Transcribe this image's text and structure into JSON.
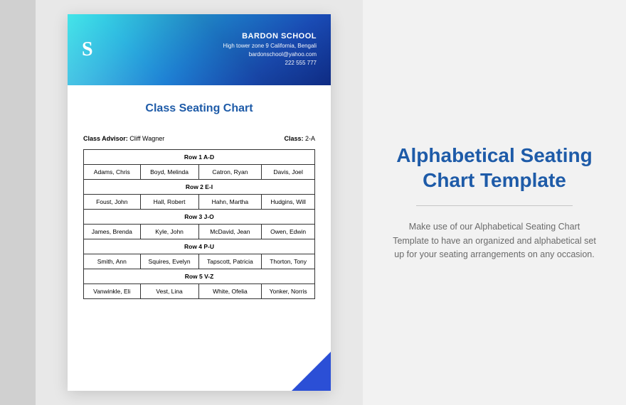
{
  "document": {
    "logo_text": "S",
    "school": {
      "name": "BARDON SCHOOL",
      "address": "High tower zone 9 California, Bengali",
      "email": "bardonschool@yahoo.com",
      "phone": "222 555 777"
    },
    "title": "Class Seating Chart",
    "meta": {
      "advisor_label": "Class Advisor:",
      "advisor_value": "Cliff Wagner",
      "class_label": "Class:",
      "class_value": "2-A"
    },
    "rows": [
      {
        "header": "Row 1 A-D",
        "cells": [
          "Adams, Chris",
          "Boyd, Melinda",
          "Catron, Ryan",
          "Davis, Joel"
        ]
      },
      {
        "header": "Row 2 E-I",
        "cells": [
          "Foust, John",
          "Hall, Robert",
          "Hahn, Martha",
          "Hudgins, Will"
        ]
      },
      {
        "header": "Row 3 J-O",
        "cells": [
          "James, Brenda",
          "Kyle, John",
          "McDavid, Jean",
          "Owen, Edwin"
        ]
      },
      {
        "header": "Row 4 P-U",
        "cells": [
          "Smith, Ann",
          "Squires, Evelyn",
          "Tapscott, Patricia",
          "Thorton, Tony"
        ]
      },
      {
        "header": "Row 5 V-Z",
        "cells": [
          "Vanwinkle, Eli",
          "Vest, Lina",
          "White, Ofelia",
          "Yonker, Norris"
        ]
      }
    ]
  },
  "panel": {
    "title": "Alphabetical Seating Chart Template",
    "description": "Make use of our Alphabetical Seating Chart Template to have an organized and alphabetical set up for your seating arrangements on any occasion."
  }
}
